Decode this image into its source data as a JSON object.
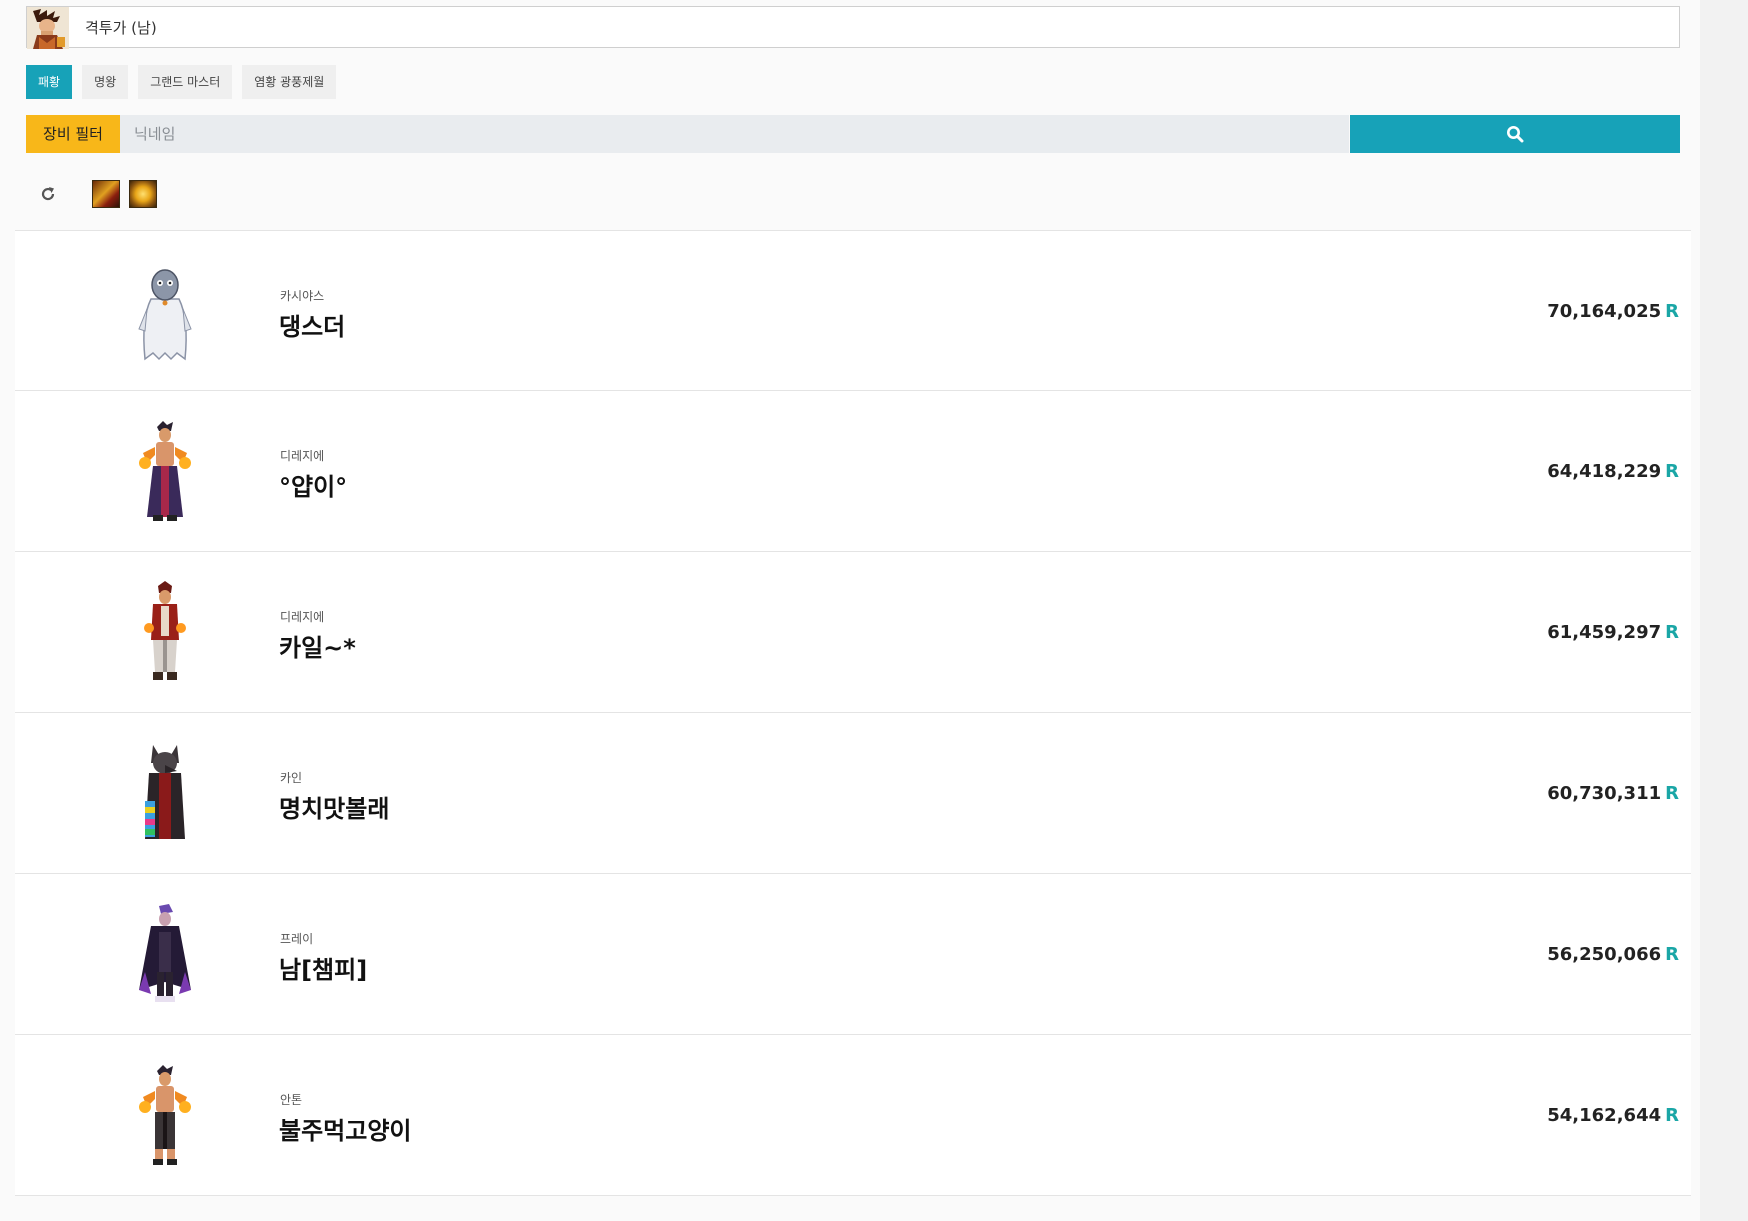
{
  "class_selector": {
    "label": "격투가 (남)",
    "avatar_icon": "fighter-male-portrait"
  },
  "tabs": [
    {
      "label": "패황",
      "active": true
    },
    {
      "label": "명왕",
      "active": false
    },
    {
      "label": "그랜드 마스터",
      "active": false
    },
    {
      "label": "염황 광풍제월",
      "active": false
    }
  ],
  "search": {
    "filter_label": "장비 필터",
    "placeholder": "닉네임",
    "value": "",
    "button_icon": "search-icon"
  },
  "toolbar": {
    "refresh_icon": "refresh-icon",
    "equipped_filters": [
      "flame-gauntlet-item-icon",
      "golden-orb-item-icon"
    ]
  },
  "ranking": {
    "unit": "R",
    "rows": [
      {
        "server": "카시야스",
        "name": "댕스더",
        "score": "70,164,025",
        "avatar": "ghost-costume-avatar"
      },
      {
        "server": "디레지에",
        "name": "°얍이°",
        "score": "64,418,229",
        "avatar": "flame-fist-fighter-avatar"
      },
      {
        "server": "디레지에",
        "name": "카일~*",
        "score": "61,459,297",
        "avatar": "red-coat-fighter-avatar"
      },
      {
        "server": "카인",
        "name": "명치맛볼래",
        "score": "60,730,311",
        "avatar": "wolf-costume-avatar"
      },
      {
        "server": "프레이",
        "name": "남[챔피]",
        "score": "56,250,066",
        "avatar": "dark-caped-fighter-avatar"
      },
      {
        "server": "안톤",
        "name": "불주먹고양이",
        "score": "54,162,644",
        "avatar": "flame-fist-fighter-avatar"
      }
    ]
  },
  "colors": {
    "accent": "#17a2b8",
    "filter": "#f8b719",
    "unit": "#1aa6a6"
  }
}
